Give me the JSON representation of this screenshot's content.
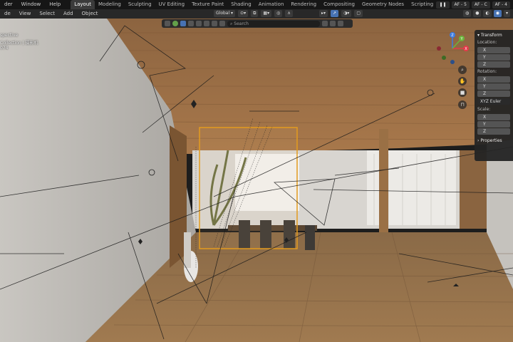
{
  "topbar": {
    "menus": [
      "der",
      "Window",
      "Help"
    ],
    "tabs": [
      "Layout",
      "Modeling",
      "Sculpting",
      "UV Editing",
      "Texture Paint",
      "Shading",
      "Animation",
      "Rendering",
      "Compositing",
      "Geometry Nodes",
      "Scripting"
    ],
    "add_tab": "+",
    "right_items": [
      "AF - 5",
      "AF - C",
      "AF - 4"
    ]
  },
  "header": {
    "mode": "de",
    "menus": [
      "View",
      "Select",
      "Add",
      "Object"
    ],
    "orientation": "Global"
  },
  "toolbar": {
    "search_placeholder": "Search"
  },
  "viewport": {
    "view_label": "spective",
    "collection_label": "Collection | 摄影机",
    "frame": "074"
  },
  "npanel": {
    "transform_title": "Transform",
    "location_label": "Location:",
    "rotation_label": "Rotation:",
    "rotation_mode": "XYZ Euler",
    "scale_label": "Scale:",
    "axes": [
      "X",
      "Y",
      "Z"
    ],
    "properties_title": "Properties"
  },
  "gizmo_axes": [
    "X",
    "Y",
    "Z"
  ],
  "colors": {
    "active_blue": "#4772b3",
    "camera_frame": "#e39b1e",
    "axis_x": "#e23b4b",
    "axis_y": "#6cb33c",
    "axis_z": "#3d7ce0"
  }
}
